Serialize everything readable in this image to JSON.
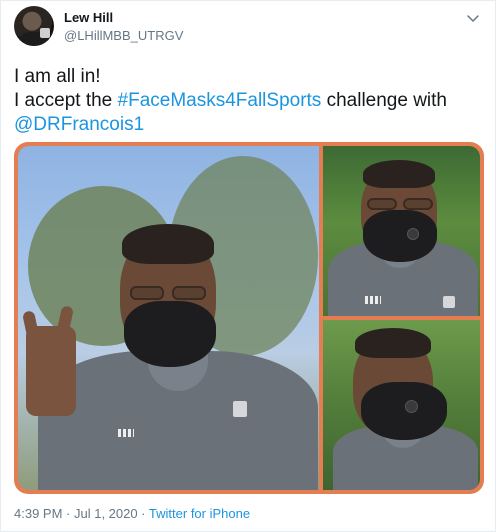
{
  "author": {
    "name": "Lew Hill",
    "handle": "@LHillMBB_UTRGV"
  },
  "tweet": {
    "line1": "I am all in!",
    "line2_prefix": "I accept the ",
    "hashtag": "#FaceMasks4FallSports",
    "line2_suffix": " challenge with",
    "mention": "@DRFrancois1"
  },
  "media": {
    "frame_color": "#e47e52",
    "photos": [
      "main-photo",
      "top-right-photo",
      "bottom-right-photo"
    ]
  },
  "meta": {
    "time": "4:39 PM",
    "separator1": " · ",
    "date": "Jul 1, 2020",
    "separator2": " · ",
    "source": "Twitter for iPhone"
  },
  "colors": {
    "link": "#1b95e0",
    "secondary_text": "#657786",
    "primary_text": "#14171a"
  },
  "icons": {
    "caret": "chevron-down-icon"
  }
}
